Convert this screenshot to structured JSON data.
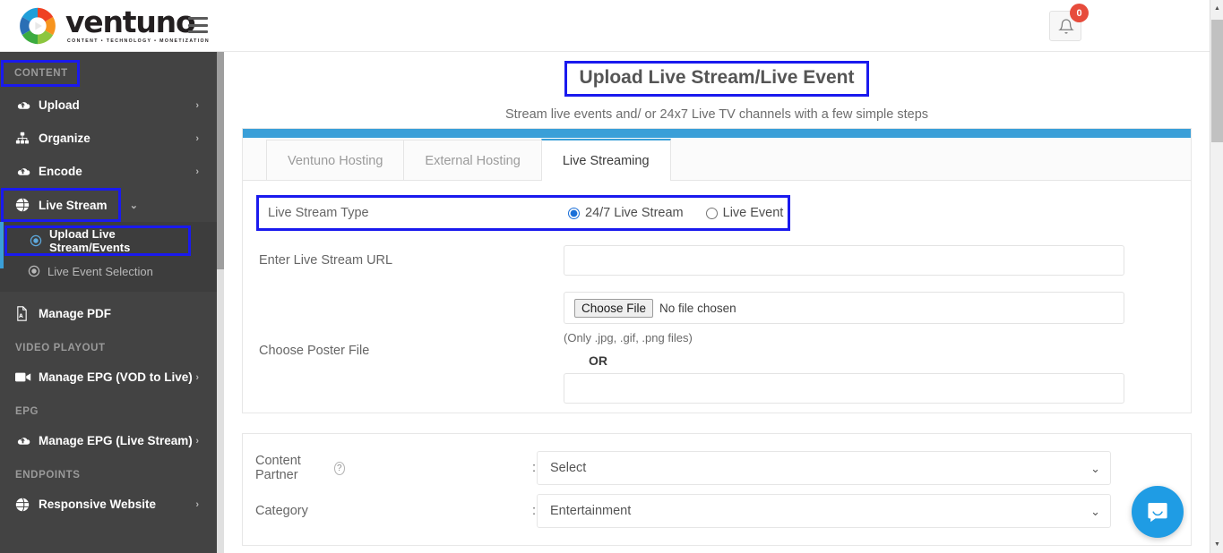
{
  "header": {
    "logo_word": "ventuno",
    "logo_tagline": "CONTENT  •  TECHNOLOGY  •  MONETIZATION",
    "menu_icon": "hamburger-icon",
    "notification_icon": "bell-icon",
    "notification_count": "0"
  },
  "sidebar": {
    "sections": [
      {
        "title": "CONTENT",
        "highlighted": true
      },
      {
        "title": "VIDEO PLAYOUT",
        "highlighted": false
      },
      {
        "title": "EPG",
        "highlighted": false
      },
      {
        "title": "ENDPOINTS",
        "highlighted": false
      }
    ],
    "items": [
      {
        "label": "Upload",
        "icon": "cloud-upload-icon",
        "chevron": "›"
      },
      {
        "label": "Organize",
        "icon": "sitemap-icon",
        "chevron": "›"
      },
      {
        "label": "Encode",
        "icon": "cloud-upload-icon",
        "chevron": "›"
      },
      {
        "label": "Live Stream",
        "icon": "globe-icon",
        "chevron": "⌄"
      },
      {
        "label": "Manage PDF",
        "icon": "pdf-file-icon",
        "chevron": ""
      },
      {
        "label": "Manage EPG (VOD to Live)",
        "icon": "video-camera-icon",
        "chevron": "›"
      },
      {
        "label": "Manage EPG (Live Stream)",
        "icon": "cloud-upload-icon",
        "chevron": "›"
      },
      {
        "label": "Responsive Website",
        "icon": "globe-icon",
        "chevron": "›"
      }
    ],
    "subitems": [
      {
        "label": "Upload Live Stream/Events",
        "icon": "radio-target-icon",
        "active": true
      },
      {
        "label": "Live Event Selection",
        "icon": "radio-target-icon",
        "active": false
      }
    ]
  },
  "main": {
    "title": "Upload Live Stream/Live Event",
    "subtitle": "Stream live events and/ or 24x7 Live TV channels with a few simple steps",
    "tabs": [
      {
        "label": "Ventuno Hosting",
        "active": false
      },
      {
        "label": "External Hosting",
        "active": false
      },
      {
        "label": "Live Streaming",
        "active": true
      }
    ],
    "form": {
      "stream_type_label": "Live Stream Type",
      "radio_options": [
        {
          "label": "24/7 Live Stream",
          "checked": true
        },
        {
          "label": "Live Event",
          "checked": false
        }
      ],
      "url_label": "Enter Live Stream URL",
      "url_value": "",
      "url_placeholder": "",
      "poster_label": "Choose Poster File",
      "file_button_label": "Choose File",
      "file_status": "No file chosen",
      "file_hint": "(Only .jpg, .gif, .png files)",
      "or_label": "OR",
      "poster_url_value": "",
      "poster_url_placeholder": ""
    },
    "settings": [
      {
        "label": "Content Partner",
        "has_help": true,
        "colon": ":",
        "value": "Select"
      },
      {
        "label": "Category",
        "has_help": false,
        "colon": ":",
        "value": "Entertainment"
      }
    ]
  },
  "chat": {
    "icon": "chat-bubble-icon"
  },
  "colors": {
    "accent_blue": "#3a9fd8",
    "highlight_box": "#1a1aee",
    "sidebar_bg": "#434343",
    "badge_red": "#e74c3c",
    "chat_blue": "#1f9ce4"
  }
}
